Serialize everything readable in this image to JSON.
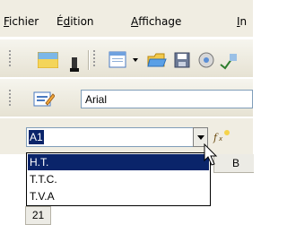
{
  "menu": {
    "items": [
      {
        "mnemonic": "F",
        "rest": "ichier"
      },
      {
        "pre": "É",
        "mnemonic": "d",
        "rest": "ition"
      },
      {
        "mnemonic": "A",
        "rest": "ffichage"
      },
      {
        "mnemonic": "I",
        "rest": "n"
      }
    ]
  },
  "toolbar": {
    "font_name": "Arial",
    "icons": [
      "color-icon",
      "paint-bucket-icon",
      "new-document-icon",
      "open-folder-icon",
      "save-icon",
      "tools-icon",
      "spellcheck-icon"
    ]
  },
  "name_box": {
    "value": "A1"
  },
  "dropdown": {
    "options": [
      "H.T.",
      "T.T.C.",
      "T.V.A"
    ],
    "highlighted_index": 0
  },
  "sheet": {
    "column_header": "B",
    "row_number": "21"
  },
  "colors": {
    "selection": "#0a246a",
    "menubar_bg": "#f0ede2"
  }
}
